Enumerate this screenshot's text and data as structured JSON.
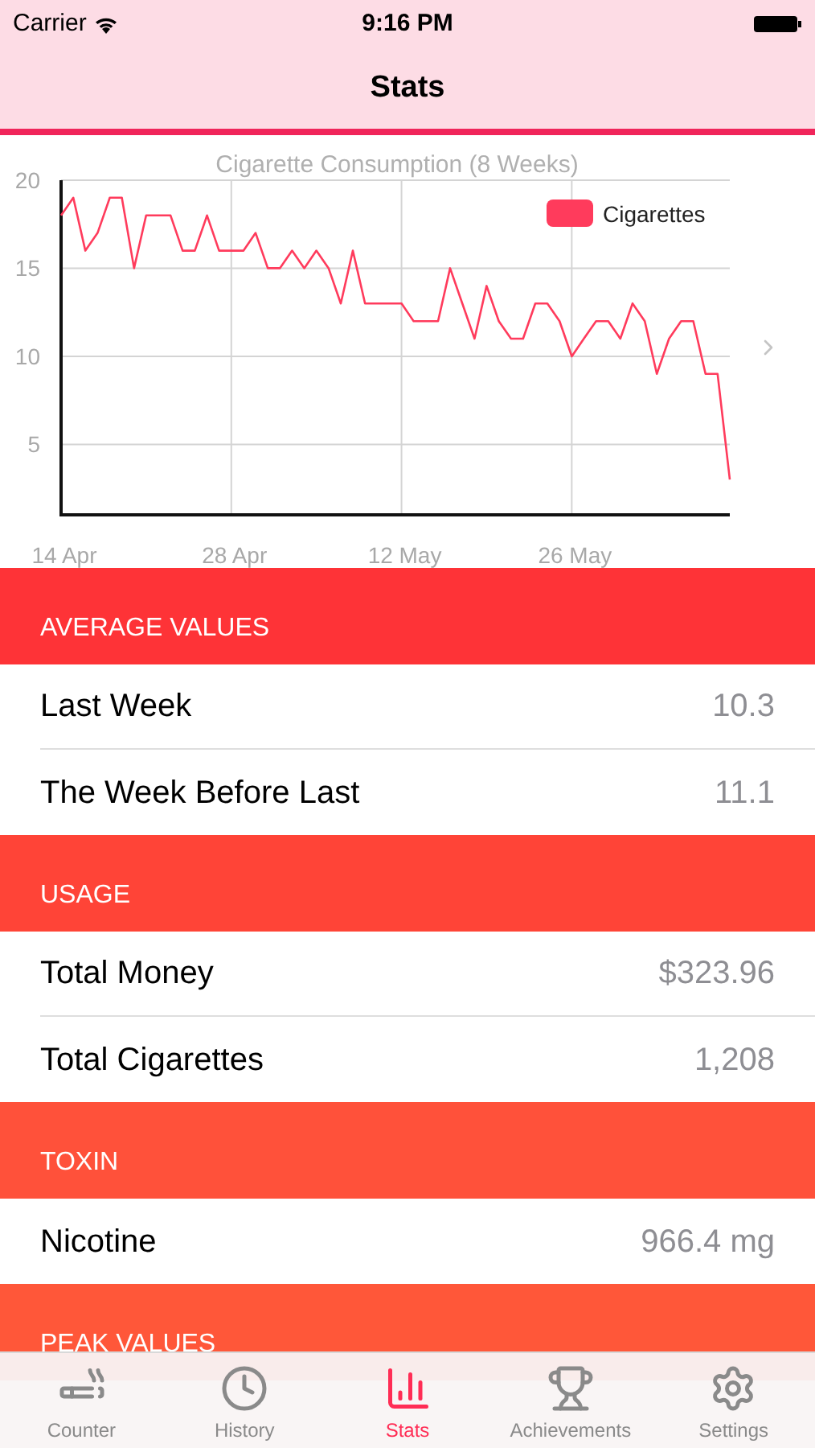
{
  "status_bar": {
    "carrier": "Carrier",
    "time": "9:16 PM"
  },
  "nav": {
    "title": "Stats"
  },
  "chart": {
    "chart_data": {
      "type": "line",
      "title": "Cigarette Consumption (8 Weeks)",
      "categories": [
        "14 Apr",
        null,
        null,
        null,
        null,
        null,
        null,
        null,
        null,
        null,
        null,
        null,
        null,
        null,
        "28 Apr",
        null,
        null,
        null,
        null,
        null,
        null,
        null,
        null,
        null,
        null,
        null,
        null,
        null,
        "12 May",
        null,
        null,
        null,
        null,
        null,
        null,
        null,
        null,
        null,
        null,
        null,
        null,
        null,
        "26 May",
        null,
        null,
        null,
        null,
        null,
        null,
        null,
        null,
        null,
        null,
        null,
        null,
        null
      ],
      "series": [
        {
          "name": "Cigarettes",
          "color": "#ff3b5c",
          "values": [
            18,
            19,
            16,
            17,
            19,
            19,
            15,
            18,
            18,
            18,
            16,
            16,
            18,
            16,
            16,
            16,
            17,
            15,
            15,
            16,
            15,
            16,
            15,
            13,
            16,
            13,
            13,
            13,
            13,
            12,
            12,
            12,
            15,
            13,
            11,
            14,
            12,
            11,
            11,
            13,
            13,
            12,
            10,
            11,
            12,
            12,
            11,
            13,
            12,
            9,
            11,
            12,
            12,
            9,
            9,
            3
          ]
        }
      ],
      "ylim": [
        1,
        20
      ],
      "grid": true,
      "yticks": [
        5,
        10,
        15,
        20
      ]
    }
  },
  "sections": [
    {
      "title": "AVERAGE VALUES",
      "rows": [
        {
          "label": "Last Week",
          "value": "10.3"
        },
        {
          "label": "The Week Before Last",
          "value": "11.1"
        }
      ]
    },
    {
      "title": "USAGE",
      "rows": [
        {
          "label": "Total Money",
          "value": "$323.96"
        },
        {
          "label": "Total Cigarettes",
          "value": "1,208"
        }
      ]
    },
    {
      "title": "TOXIN",
      "rows": [
        {
          "label": "Nicotine",
          "value": "966.4 mg"
        }
      ]
    },
    {
      "title": "PEAK VALUES"
    }
  ],
  "tab_bar": [
    {
      "kind": "cigarette",
      "label": "Counter",
      "selected": false
    },
    {
      "kind": "clock",
      "label": "History",
      "selected": false
    },
    {
      "kind": "chart",
      "label": "Stats",
      "selected": true
    },
    {
      "kind": "trophy",
      "label": "Achievements",
      "selected": false
    },
    {
      "kind": "gear",
      "label": "Settings",
      "selected": false
    }
  ]
}
